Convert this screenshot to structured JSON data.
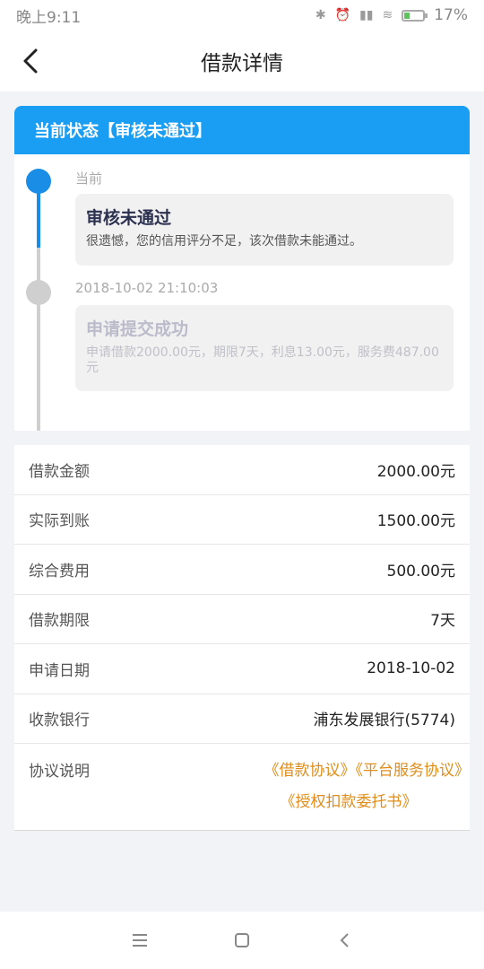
{
  "status_bar": {
    "time": "晚上9:11",
    "battery": "17%"
  },
  "header": {
    "title": "借款详情"
  },
  "status_card": {
    "heading": "当前状态【审核未通过】",
    "events": [
      {
        "label": "当前",
        "title": "审核未通过",
        "desc": "很遗憾，您的信用评分不足，该次借款未能通过。"
      },
      {
        "label": "2018-10-02 21:10:03",
        "title": "申请提交成功",
        "desc": "申请借款2000.00元，期限7天，利息13.00元，服务费487.00元"
      }
    ]
  },
  "details": [
    {
      "label": "借款金额",
      "value": "2000.00元"
    },
    {
      "label": "实际到账",
      "value": "1500.00元"
    },
    {
      "label": "综合费用",
      "value": "500.00元"
    },
    {
      "label": "借款期限",
      "value": "7天"
    },
    {
      "label": "申请日期",
      "value": "2018-10-02"
    },
    {
      "label": "收款银行",
      "value": "浦东发展银行(5774)"
    }
  ],
  "agreement": {
    "label": "协议说明",
    "links": [
      "《借款协议》《平台服务协议》",
      "《授权扣款委托书》"
    ]
  },
  "colors": {
    "accent": "#1a9ef3",
    "link": "#e08d1a"
  }
}
